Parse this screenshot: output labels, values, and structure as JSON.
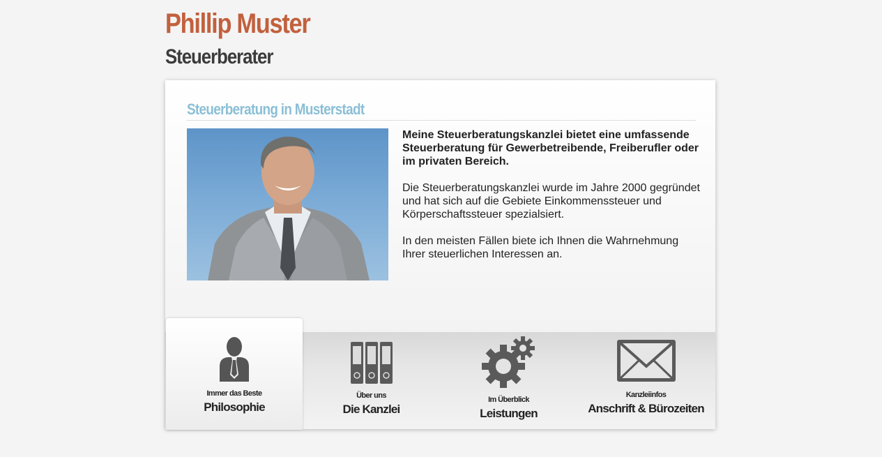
{
  "header": {
    "title": "Phillip Muster",
    "subtitle": "Steuerberater"
  },
  "main": {
    "heading": "Steuerberatung in Musterstadt",
    "lead": "Meine Steuerberatungskanzlei bietet eine umfassende Steuerberatung für Gewerbetreibende, Freiberufler oder im privaten Bereich.",
    "paragraph_1": "Die Steuerberatungskanzlei wurde im Jahre 2000 gegründet und hat sich auf die Gebiete Einkommenssteuer und Körperschaftssteuer spezialsiert.",
    "paragraph_2": "In den meisten Fällen biete ich Ihnen die Wahrnehmung Ihrer steuerlichen Interessen an."
  },
  "tabs": [
    {
      "kicker": "Immer das Beste",
      "label": "Philosophie",
      "icon": "person-icon",
      "active": true
    },
    {
      "kicker": "Über uns",
      "label": "Die Kanzlei",
      "icon": "binders-icon",
      "active": false
    },
    {
      "kicker": "Im Überblick",
      "label": "Leistungen",
      "icon": "gears-icon",
      "active": false
    },
    {
      "kicker": "Kanzleiinfos",
      "label": "Anschrift & Bürozeiten",
      "icon": "envelope-icon",
      "active": false
    }
  ],
  "colors": {
    "title": "#c2603e",
    "heading": "#8bbfd6",
    "text": "#222222"
  }
}
